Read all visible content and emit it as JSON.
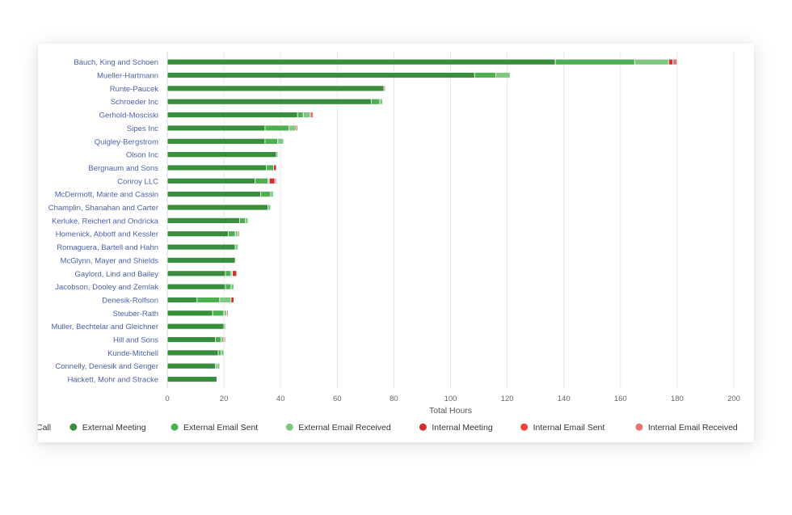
{
  "chart_data": {
    "type": "bar",
    "orientation": "horizontal",
    "stacked": true,
    "title": "",
    "xlabel": "Total Hours",
    "ylabel": "",
    "xlim": [
      0,
      200
    ],
    "xticks": [
      0,
      20,
      40,
      60,
      80,
      100,
      120,
      140,
      160,
      180,
      200
    ],
    "grid": true,
    "legend_position": "bottom",
    "categories": [
      "Bauch, King and Schoen",
      "Mueller-Hartmann",
      "Runte-Paucek",
      "Schroeder Inc",
      "Gerhold-Mosciski",
      "Sipes Inc",
      "Quigley-Bergstrom",
      "Olson Inc",
      "Bergnaum and Sons",
      "Conroy LLC",
      "McDermott, Mante and Cassin",
      "Champlin, Shanahan and Carter",
      "Kerluke, Reichert and Ondricka",
      "Homenick, Abbott and Kessler",
      "Romaguera, Bartell and Hahn",
      "McGlynn, Mayer and Shields",
      "Gaylord, Lind and Bailey",
      "Jacobson, Dooley and Zemlak",
      "Denesik-Rolfson",
      "Steuber-Rath",
      "Muller, Bechtelar and Gleichner",
      "Hill and Sons",
      "Kunde-Mitchell",
      "Connelly, Denesik and Senger",
      "Hackett, Mohr and Stracke"
    ],
    "series": [
      {
        "name": "Call",
        "color": "#1b5e20",
        "values": [
          0,
          0,
          0,
          0,
          0,
          0,
          0,
          0,
          0,
          0,
          0,
          0,
          0,
          0,
          0,
          0,
          0,
          0,
          0,
          0,
          0,
          0,
          0,
          0,
          0
        ]
      },
      {
        "name": "External Meeting",
        "color": "#388e3c",
        "values": [
          137,
          108.5,
          76.5,
          72,
          46,
          34.5,
          34.5,
          38.5,
          35,
          31,
          33,
          35.5,
          25.5,
          21.5,
          24,
          24,
          20.5,
          20.5,
          10.5,
          16,
          20,
          17,
          18,
          17,
          17.5
        ]
      },
      {
        "name": "External Email Sent",
        "color": "#4caf50",
        "values": [
          28,
          7.5,
          0,
          3,
          2,
          8.5,
          4.5,
          0.5,
          2.5,
          4.5,
          3.5,
          0,
          2,
          2.5,
          0,
          0,
          2,
          2,
          8,
          4,
          0.5,
          2,
          1,
          0.5,
          0
        ]
      },
      {
        "name": "External Email Received",
        "color": "#81c784",
        "values": [
          12,
          5,
          0,
          1,
          2.5,
          2.5,
          2,
          0,
          0,
          0.5,
          1,
          1,
          1,
          1,
          1,
          0,
          0.5,
          1,
          4,
          1,
          0,
          1,
          1,
          1,
          0
        ]
      },
      {
        "name": "Internal Meeting",
        "color": "#d32f2f",
        "values": [
          1.5,
          0,
          0,
          0,
          0,
          0,
          0,
          0,
          1,
          2,
          0,
          0,
          0,
          0,
          0,
          0,
          1.5,
          0,
          1,
          0,
          0,
          0,
          0,
          0,
          0
        ]
      },
      {
        "name": "Internal Email Sent",
        "color": "#f44336",
        "values": [
          0,
          0,
          0,
          0,
          0,
          0.5,
          0,
          0,
          0,
          0,
          0,
          0,
          0,
          0,
          0,
          0,
          0,
          0,
          0,
          0,
          0,
          0,
          0,
          0,
          0
        ]
      },
      {
        "name": "Internal Email Received",
        "color": "#e57373",
        "values": [
          1.5,
          0,
          0.5,
          0,
          1,
          0,
          0,
          0,
          0,
          0.5,
          0,
          0,
          0,
          0.5,
          0,
          0,
          0,
          0,
          0,
          0.5,
          0,
          0.5,
          0,
          0,
          0
        ]
      }
    ]
  }
}
